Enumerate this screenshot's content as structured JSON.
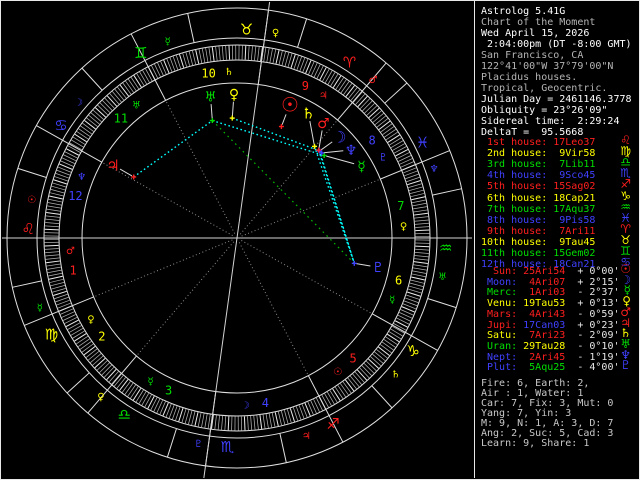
{
  "app": {
    "name": "Astrolog 5.41G"
  },
  "palette": {
    "red": "#ff1f1f",
    "yellow": "#ffff00",
    "green": "#00dd00",
    "blue": "#4040ff",
    "cyan": "#00ffff",
    "aspect_green": "#00bb00",
    "white": "#ffffff",
    "dim": "#b4b4b4",
    "gray": "#c8c8c8",
    "line": "#e0e0e0",
    "tick": "#b0b0b0",
    "tick5": "#ececec",
    "spoke": "#8c8c8c",
    "axis": "#d4d4d4",
    "fire": "#ff1f1f",
    "earth": "#ffff00",
    "air": "#00dd00",
    "water": "#4040ff"
  },
  "info_panel": {
    "header_lines": [
      {
        "text": "Astrolog 5.41G",
        "bright": true
      },
      {
        "text": "Chart of the Moment",
        "bright": false
      },
      {
        "text": "Wed April 15, 2026",
        "bright": true
      },
      {
        "text": " 2:04:00pm (DT -8:00 GMT)",
        "bright": true
      },
      {
        "text": "San Francisco, CA",
        "bright": false
      },
      {
        "text": "122°41'00\"W 37°79'00\"N",
        "bright": false
      },
      {
        "text": "Placidus houses.",
        "bright": false
      },
      {
        "text": "Tropical, Geocentric.",
        "bright": false
      },
      {
        "text": "Julian Day = 2461146.3778",
        "bright": true
      },
      {
        "text": "Obliquity = 23°26'09\"",
        "bright": true
      },
      {
        "text": "Sidereal time:  2:29:24",
        "bright": true
      },
      {
        "text": "DeltaT =  95.5668",
        "bright": true
      }
    ],
    "houses": [
      {
        "label": "1st house:",
        "value": "17Leo37",
        "glyph": "♌",
        "element": "fire"
      },
      {
        "label": "2nd house:",
        "value": "9Vir58",
        "glyph": "♍",
        "element": "earth"
      },
      {
        "label": "3rd house:",
        "value": "7Lib11",
        "glyph": "♎",
        "element": "air"
      },
      {
        "label": "4th house:",
        "value": "9Sco45",
        "glyph": "♏",
        "element": "water"
      },
      {
        "label": "5th house:",
        "value": "15Sag02",
        "glyph": "♐",
        "element": "fire"
      },
      {
        "label": "6th house:",
        "value": "18Cap21",
        "glyph": "♑",
        "element": "earth"
      },
      {
        "label": "7th house:",
        "value": "17Aqu37",
        "glyph": "♒",
        "element": "air"
      },
      {
        "label": "8th house:",
        "value": "9Pis58",
        "glyph": "♓",
        "element": "water"
      },
      {
        "label": "9th house:",
        "value": "7Ari11",
        "glyph": "♈",
        "element": "fire"
      },
      {
        "label": "10th house:",
        "value": "9Tau45",
        "glyph": "♉",
        "element": "earth"
      },
      {
        "label": "11th house:",
        "value": "15Gem02",
        "glyph": "♊",
        "element": "air"
      },
      {
        "label": "12th house:",
        "value": "18Can21",
        "glyph": "♋",
        "element": "water"
      }
    ],
    "planets": [
      {
        "label": "Sun:",
        "value": "25Ari54",
        "velocity": "+ 0°00'",
        "glyph": "☉",
        "color": "red",
        "value_element": "fire"
      },
      {
        "label": "Moon:",
        "value": "4Ari07",
        "velocity": "+ 2°15'",
        "glyph": "☽",
        "color": "blue",
        "value_element": "fire"
      },
      {
        "label": "Merc:",
        "value": "1Ari03",
        "velocity": "- 2°37'",
        "glyph": "☿",
        "color": "green",
        "value_element": "fire"
      },
      {
        "label": "Venu:",
        "value": "19Tau53",
        "velocity": "+ 0°13'",
        "glyph": "♀",
        "color": "yellow",
        "value_element": "earth"
      },
      {
        "label": "Mars:",
        "value": "4Ari43",
        "velocity": "- 0°59'",
        "glyph": "♂",
        "color": "red",
        "value_element": "fire"
      },
      {
        "label": "Jupi:",
        "value": "17Can03",
        "velocity": "+ 0°23'",
        "glyph": "♃",
        "color": "red",
        "value_element": "water"
      },
      {
        "label": "Satu:",
        "value": "7Ari23",
        "velocity": "- 2°09'",
        "glyph": "♄",
        "color": "yellow",
        "value_element": "fire"
      },
      {
        "label": "Uran:",
        "value": "29Tau28",
        "velocity": "- 0°10'",
        "glyph": "♅",
        "color": "green",
        "value_element": "earth"
      },
      {
        "label": "Nept:",
        "value": "2Ari45",
        "velocity": "- 1°19'",
        "glyph": "♆",
        "color": "blue",
        "value_element": "fire"
      },
      {
        "label": "Plut:",
        "value": "5Aqu25",
        "velocity": "- 4°00'",
        "glyph": "♇",
        "color": "blue",
        "value_element": "air"
      }
    ],
    "totals": [
      "Fire: 6, Earth: 2,",
      "Air : 1, Water: 1",
      "Car: 7, Fix: 3, Mut: 0",
      "Yang: 7, Yin: 3",
      "M: 9, N: 1, A: 3, D: 7",
      "Ang: 2, Suc: 5, Cad: 3",
      "Learn: 9, Share: 1"
    ]
  },
  "chart_data": {
    "type": "astrology-wheel",
    "ascendant_deg": 137.617,
    "house_cusps_deg": [
      137.617,
      159.967,
      187.183,
      219.75,
      255.033,
      288.35,
      317.617,
      339.967,
      7.183,
      39.75,
      75.033,
      108.35
    ],
    "signs": [
      {
        "name": "Aries",
        "glyph": "♈",
        "element": "fire",
        "ruler_glyph": "♂",
        "ruler_color": "red"
      },
      {
        "name": "Taurus",
        "glyph": "♉",
        "element": "earth",
        "ruler_glyph": "♀",
        "ruler_color": "yellow"
      },
      {
        "name": "Gemini",
        "glyph": "♊",
        "element": "air",
        "ruler_glyph": "☿",
        "ruler_color": "green"
      },
      {
        "name": "Cancer",
        "glyph": "♋",
        "element": "water",
        "ruler_glyph": "☽",
        "ruler_color": "blue"
      },
      {
        "name": "Leo",
        "glyph": "♌",
        "element": "fire",
        "ruler_glyph": "☉",
        "ruler_color": "red"
      },
      {
        "name": "Virgo",
        "glyph": "♍",
        "element": "earth",
        "ruler_glyph": "☿",
        "ruler_color": "green"
      },
      {
        "name": "Libra",
        "glyph": "♎",
        "element": "air",
        "ruler_glyph": "♀",
        "ruler_color": "yellow"
      },
      {
        "name": "Scorpio",
        "glyph": "♏",
        "element": "water",
        "ruler_glyph": "♇",
        "ruler_color": "blue"
      },
      {
        "name": "Sagittarius",
        "glyph": "♐",
        "element": "fire",
        "ruler_glyph": "♃",
        "ruler_color": "red"
      },
      {
        "name": "Capricorn",
        "glyph": "♑",
        "element": "earth",
        "ruler_glyph": "♄",
        "ruler_color": "yellow"
      },
      {
        "name": "Aquarius",
        "glyph": "♒",
        "element": "air",
        "ruler_glyph": "♅",
        "ruler_color": "green"
      },
      {
        "name": "Pisces",
        "glyph": "♓",
        "element": "water",
        "ruler_glyph": "♆",
        "ruler_color": "blue"
      }
    ],
    "house_ring": [
      {
        "number": 1,
        "element": "fire",
        "ruler_glyph": "♂",
        "ruler_color": "red"
      },
      {
        "number": 2,
        "element": "earth",
        "ruler_glyph": "♀",
        "ruler_color": "yellow"
      },
      {
        "number": 3,
        "element": "air",
        "ruler_glyph": "☿",
        "ruler_color": "green"
      },
      {
        "number": 4,
        "element": "water",
        "ruler_glyph": "☽",
        "ruler_color": "blue"
      },
      {
        "number": 5,
        "element": "fire",
        "ruler_glyph": "☉",
        "ruler_color": "red"
      },
      {
        "number": 6,
        "element": "earth",
        "ruler_glyph": "☿",
        "ruler_color": "green"
      },
      {
        "number": 7,
        "element": "air",
        "ruler_glyph": "♀",
        "ruler_color": "yellow"
      },
      {
        "number": 8,
        "element": "water",
        "ruler_glyph": "♇",
        "ruler_color": "blue"
      },
      {
        "number": 9,
        "element": "fire",
        "ruler_glyph": "♃",
        "ruler_color": "red"
      },
      {
        "number": 10,
        "element": "earth",
        "ruler_glyph": "♄",
        "ruler_color": "yellow"
      },
      {
        "number": 11,
        "element": "air",
        "ruler_glyph": "♅",
        "ruler_color": "green"
      },
      {
        "number": 12,
        "element": "water",
        "ruler_glyph": "♆",
        "ruler_color": "blue"
      }
    ],
    "planets": [
      {
        "name": "Sun",
        "glyph": "☉",
        "color": "red",
        "longitude_deg": 25.9,
        "glyph_angle_deg": 68.4,
        "glyph_size": 20
      },
      {
        "name": "Moon",
        "glyph": "☽",
        "color": "blue",
        "longitude_deg": 4.117,
        "glyph_angle_deg": 44.7,
        "glyph_size": 16
      },
      {
        "name": "Mercury",
        "glyph": "☿",
        "color": "green",
        "longitude_deg": 1.05,
        "glyph_angle_deg": 30.1,
        "glyph_size": 14
      },
      {
        "name": "Venus",
        "glyph": "♀",
        "color": "yellow",
        "longitude_deg": 49.883,
        "glyph_angle_deg": 91.2,
        "glyph_size": 14
      },
      {
        "name": "Mars",
        "glyph": "♂",
        "color": "red",
        "longitude_deg": 4.717,
        "glyph_angle_deg": 53.1,
        "glyph_size": 14
      },
      {
        "name": "Jupiter",
        "glyph": "♃",
        "color": "red",
        "longitude_deg": 107.05,
        "glyph_angle_deg": 149.5,
        "glyph_size": 15
      },
      {
        "name": "Saturn",
        "glyph": "♄",
        "color": "yellow",
        "longitude_deg": 7.383,
        "glyph_angle_deg": 60.3,
        "glyph_size": 15
      },
      {
        "name": "Uranus",
        "glyph": "♅",
        "color": "green",
        "longitude_deg": 59.467,
        "glyph_angle_deg": 100.6,
        "glyph_size": 14
      },
      {
        "name": "Neptune",
        "glyph": "♆",
        "color": "blue",
        "longitude_deg": 2.75,
        "glyph_angle_deg": 37.7,
        "glyph_size": 14
      },
      {
        "name": "Pluto",
        "glyph": "♇",
        "color": "blue",
        "longitude_deg": 305.417,
        "glyph_angle_deg": 348.3,
        "glyph_size": 14
      }
    ],
    "aspects": [
      {
        "from": "Jupiter",
        "to": "Uranus",
        "color": "cyan"
      },
      {
        "from": "Venus",
        "to": "Moon",
        "color": "cyan"
      },
      {
        "from": "Uranus",
        "to": "Mercury",
        "color": "cyan"
      },
      {
        "from": "Moon",
        "to": "Pluto",
        "color": "cyan"
      },
      {
        "from": "Mars",
        "to": "Pluto",
        "color": "cyan"
      },
      {
        "from": "Saturn",
        "to": "Pluto",
        "color": "cyan"
      },
      {
        "from": "Uranus",
        "to": "Pluto",
        "color": "aspect_green"
      }
    ],
    "layout": {
      "center": [
        237,
        238
      ],
      "radii": {
        "outer": 230,
        "sign_inner": 200,
        "band_outer": 193,
        "band_inner": 178,
        "house_inner": 155,
        "dot": 120,
        "glyph": 144,
        "sign_text": 209,
        "house_text": 167
      }
    }
  }
}
